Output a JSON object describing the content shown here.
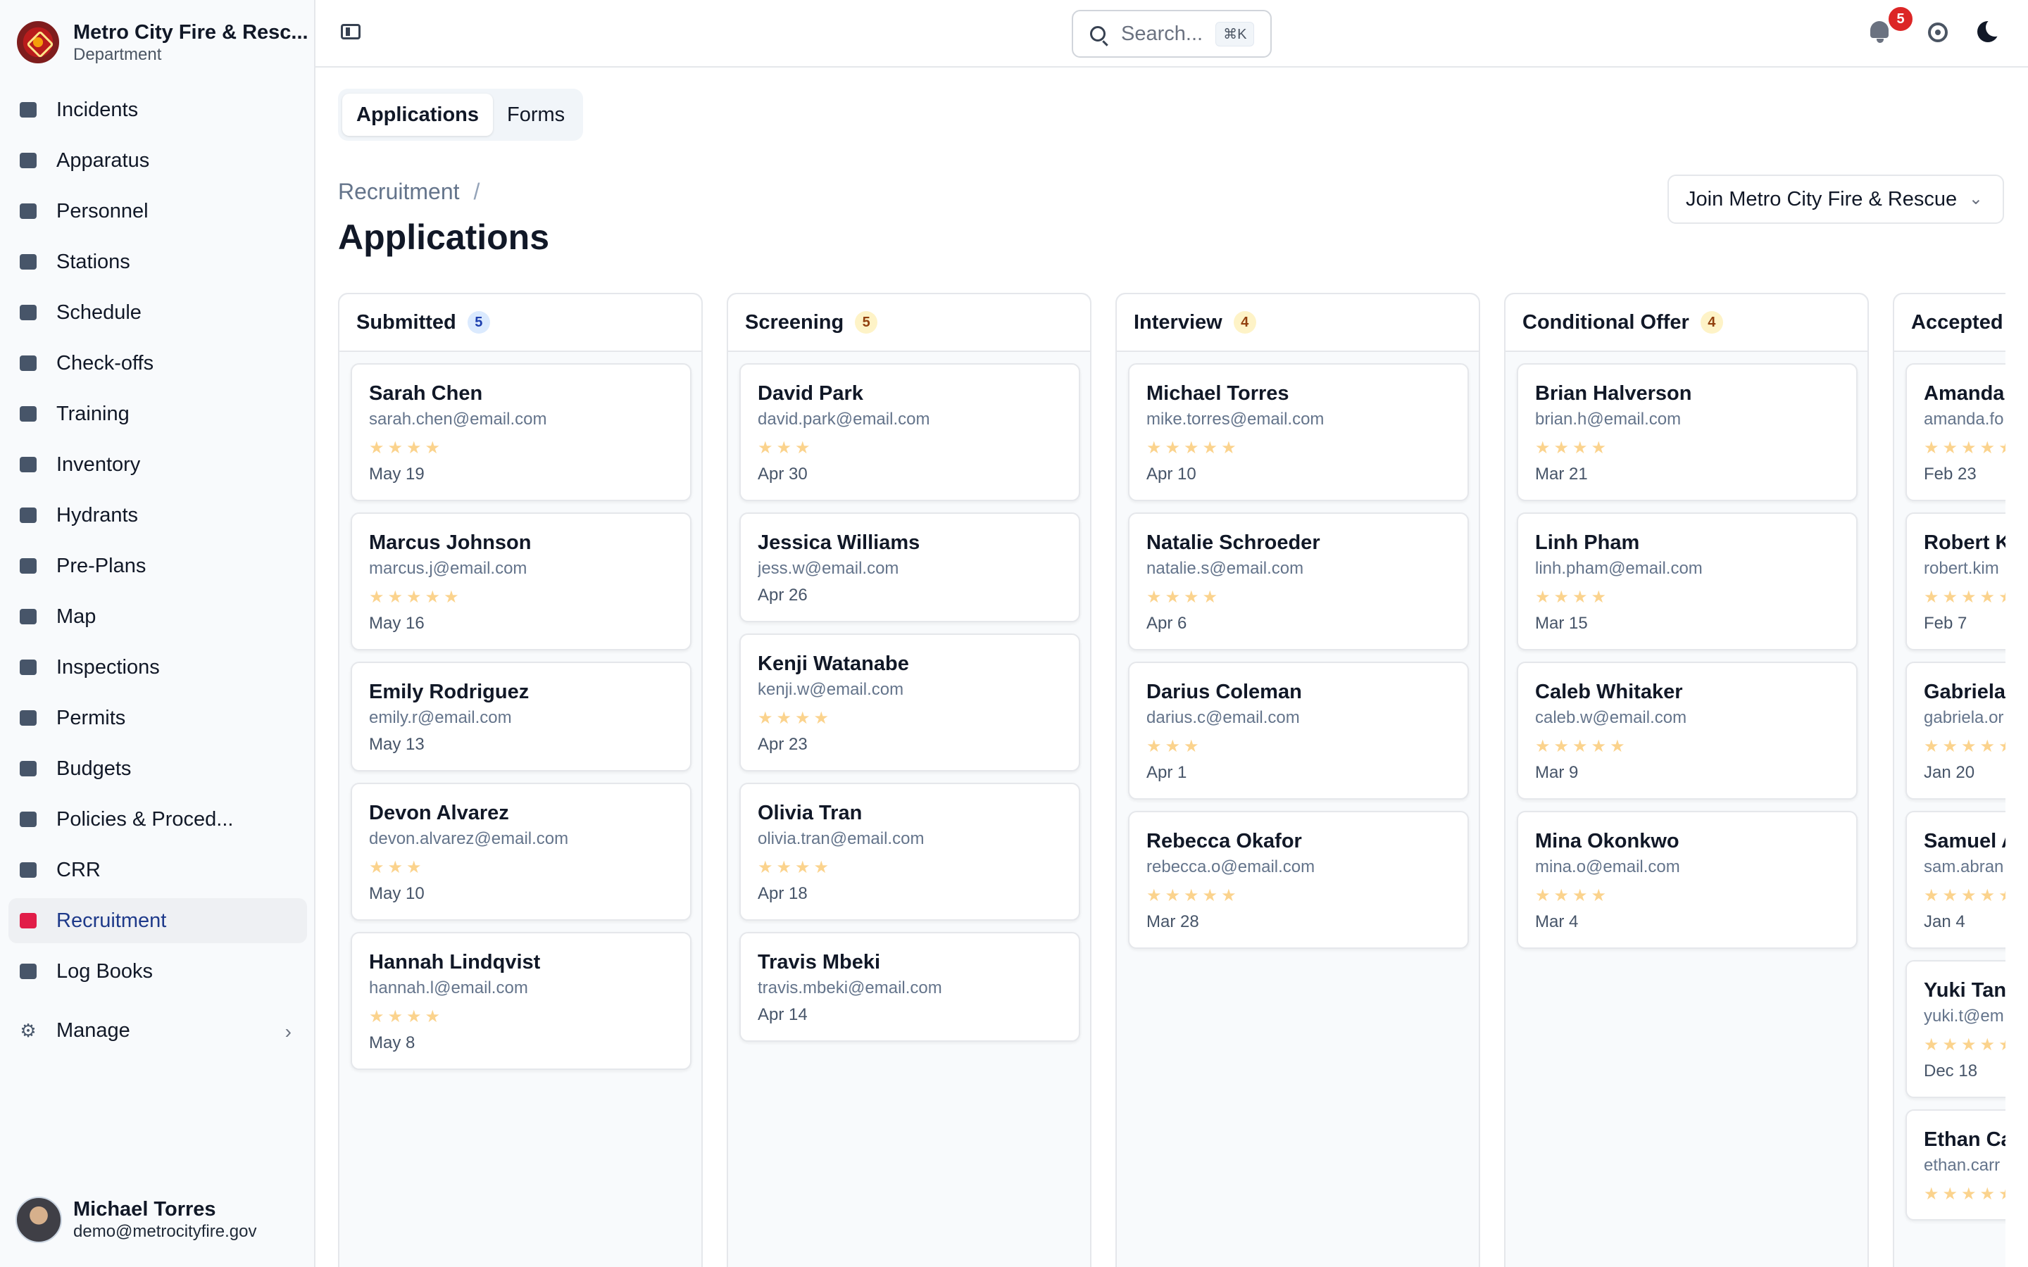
{
  "org": {
    "name": "Metro City Fire & Resc...",
    "subtitle": "Department"
  },
  "sidebar": {
    "items": [
      {
        "label": "Incidents",
        "icon": "incidents-icon"
      },
      {
        "label": "Apparatus",
        "icon": "truck-icon"
      },
      {
        "label": "Personnel",
        "icon": "id-card-icon"
      },
      {
        "label": "Stations",
        "icon": "building-icon"
      },
      {
        "label": "Schedule",
        "icon": "calendar-icon"
      },
      {
        "label": "Check-offs",
        "icon": "clipboard-check-icon"
      },
      {
        "label": "Training",
        "icon": "graduation-cap-icon"
      },
      {
        "label": "Inventory",
        "icon": "tools-icon"
      },
      {
        "label": "Hydrants",
        "icon": "hydrant-icon"
      },
      {
        "label": "Pre-Plans",
        "icon": "floorplan-icon"
      },
      {
        "label": "Map",
        "icon": "map-icon"
      },
      {
        "label": "Inspections",
        "icon": "inspection-icon"
      },
      {
        "label": "Permits",
        "icon": "permit-icon"
      },
      {
        "label": "Budgets",
        "icon": "piggy-bank-icon"
      },
      {
        "label": "Policies & Proced...",
        "icon": "books-icon"
      },
      {
        "label": "CRR",
        "icon": "megaphone-icon"
      },
      {
        "label": "Recruitment",
        "icon": "handshake-icon",
        "active": true
      },
      {
        "label": "Log Books",
        "icon": "logbook-icon"
      }
    ],
    "manage_label": "Manage"
  },
  "user": {
    "name": "Michael Torres",
    "email": "demo@metrocityfire.gov"
  },
  "topbar": {
    "search_placeholder": "Search...",
    "search_shortcut": "⌘K",
    "notifications_count": "5"
  },
  "tabs": [
    {
      "label": "Applications",
      "active": true
    },
    {
      "label": "Forms"
    }
  ],
  "breadcrumb": {
    "parent": "Recruitment",
    "separator": "/"
  },
  "page_title": "Applications",
  "join_select": {
    "value": "Join Metro City Fire & Rescue"
  },
  "colors": {
    "star": "#fbd38d",
    "badge": "#dc2626",
    "active_nav": "#1e3a8a"
  },
  "board": {
    "columns": [
      {
        "title": "Submitted",
        "count": "5",
        "count_color": "blue",
        "cards": [
          {
            "name": "Sarah Chen",
            "email": "sarah.chen@email.com",
            "rating": 4,
            "date": "May 19"
          },
          {
            "name": "Marcus Johnson",
            "email": "marcus.j@email.com",
            "rating": 5,
            "date": "May 16"
          },
          {
            "name": "Emily Rodriguez",
            "email": "emily.r@email.com",
            "rating": 0,
            "date": "May 13"
          },
          {
            "name": "Devon Alvarez",
            "email": "devon.alvarez@email.com",
            "rating": 3,
            "date": "May 10"
          },
          {
            "name": "Hannah Lindqvist",
            "email": "hannah.l@email.com",
            "rating": 4,
            "date": "May 8"
          }
        ]
      },
      {
        "title": "Screening",
        "count": "5",
        "count_color": "yellow",
        "cards": [
          {
            "name": "David Park",
            "email": "david.park@email.com",
            "rating": 3,
            "date": "Apr 30"
          },
          {
            "name": "Jessica Williams",
            "email": "jess.w@email.com",
            "rating": 0,
            "date": "Apr 26"
          },
          {
            "name": "Kenji Watanabe",
            "email": "kenji.w@email.com",
            "rating": 4,
            "date": "Apr 23"
          },
          {
            "name": "Olivia Tran",
            "email": "olivia.tran@email.com",
            "rating": 4,
            "date": "Apr 18"
          },
          {
            "name": "Travis Mbeki",
            "email": "travis.mbeki@email.com",
            "rating": 0,
            "date": "Apr 14"
          }
        ]
      },
      {
        "title": "Interview",
        "count": "4",
        "count_color": "yellow",
        "cards": [
          {
            "name": "Michael Torres",
            "email": "mike.torres@email.com",
            "rating": 5,
            "date": "Apr 10"
          },
          {
            "name": "Natalie Schroeder",
            "email": "natalie.s@email.com",
            "rating": 4,
            "date": "Apr 6"
          },
          {
            "name": "Darius Coleman",
            "email": "darius.c@email.com",
            "rating": 3,
            "date": "Apr 1"
          },
          {
            "name": "Rebecca Okafor",
            "email": "rebecca.o@email.com",
            "rating": 5,
            "date": "Mar 28"
          }
        ]
      },
      {
        "title": "Conditional Offer",
        "count": "4",
        "count_color": "yellow",
        "cards": [
          {
            "name": "Brian Halverson",
            "email": "brian.h@email.com",
            "rating": 4,
            "date": "Mar 21"
          },
          {
            "name": "Linh Pham",
            "email": "linh.pham@email.com",
            "rating": 4,
            "date": "Mar 15"
          },
          {
            "name": "Caleb Whitaker",
            "email": "caleb.w@email.com",
            "rating": 5,
            "date": "Mar 9"
          },
          {
            "name": "Mina Okonkwo",
            "email": "mina.o@email.com",
            "rating": 4,
            "date": "Mar 4"
          }
        ]
      },
      {
        "title": "Accepted",
        "count": "",
        "count_color": "",
        "cards": [
          {
            "name": "Amanda",
            "email": "amanda.fo",
            "rating": 5,
            "date": "Feb 23"
          },
          {
            "name": "Robert K",
            "email": "robert.kim",
            "rating": 5,
            "date": "Feb 7"
          },
          {
            "name": "Gabriela",
            "email": "gabriela.or",
            "rating": 5,
            "date": "Jan 20"
          },
          {
            "name": "Samuel A",
            "email": "sam.abran",
            "rating": 5,
            "date": "Jan 4"
          },
          {
            "name": "Yuki Tana",
            "email": "yuki.t@em",
            "rating": 5,
            "date": "Dec 18"
          },
          {
            "name": "Ethan Ca",
            "email": "ethan.carr",
            "rating": 5,
            "date": ""
          }
        ]
      }
    ]
  }
}
